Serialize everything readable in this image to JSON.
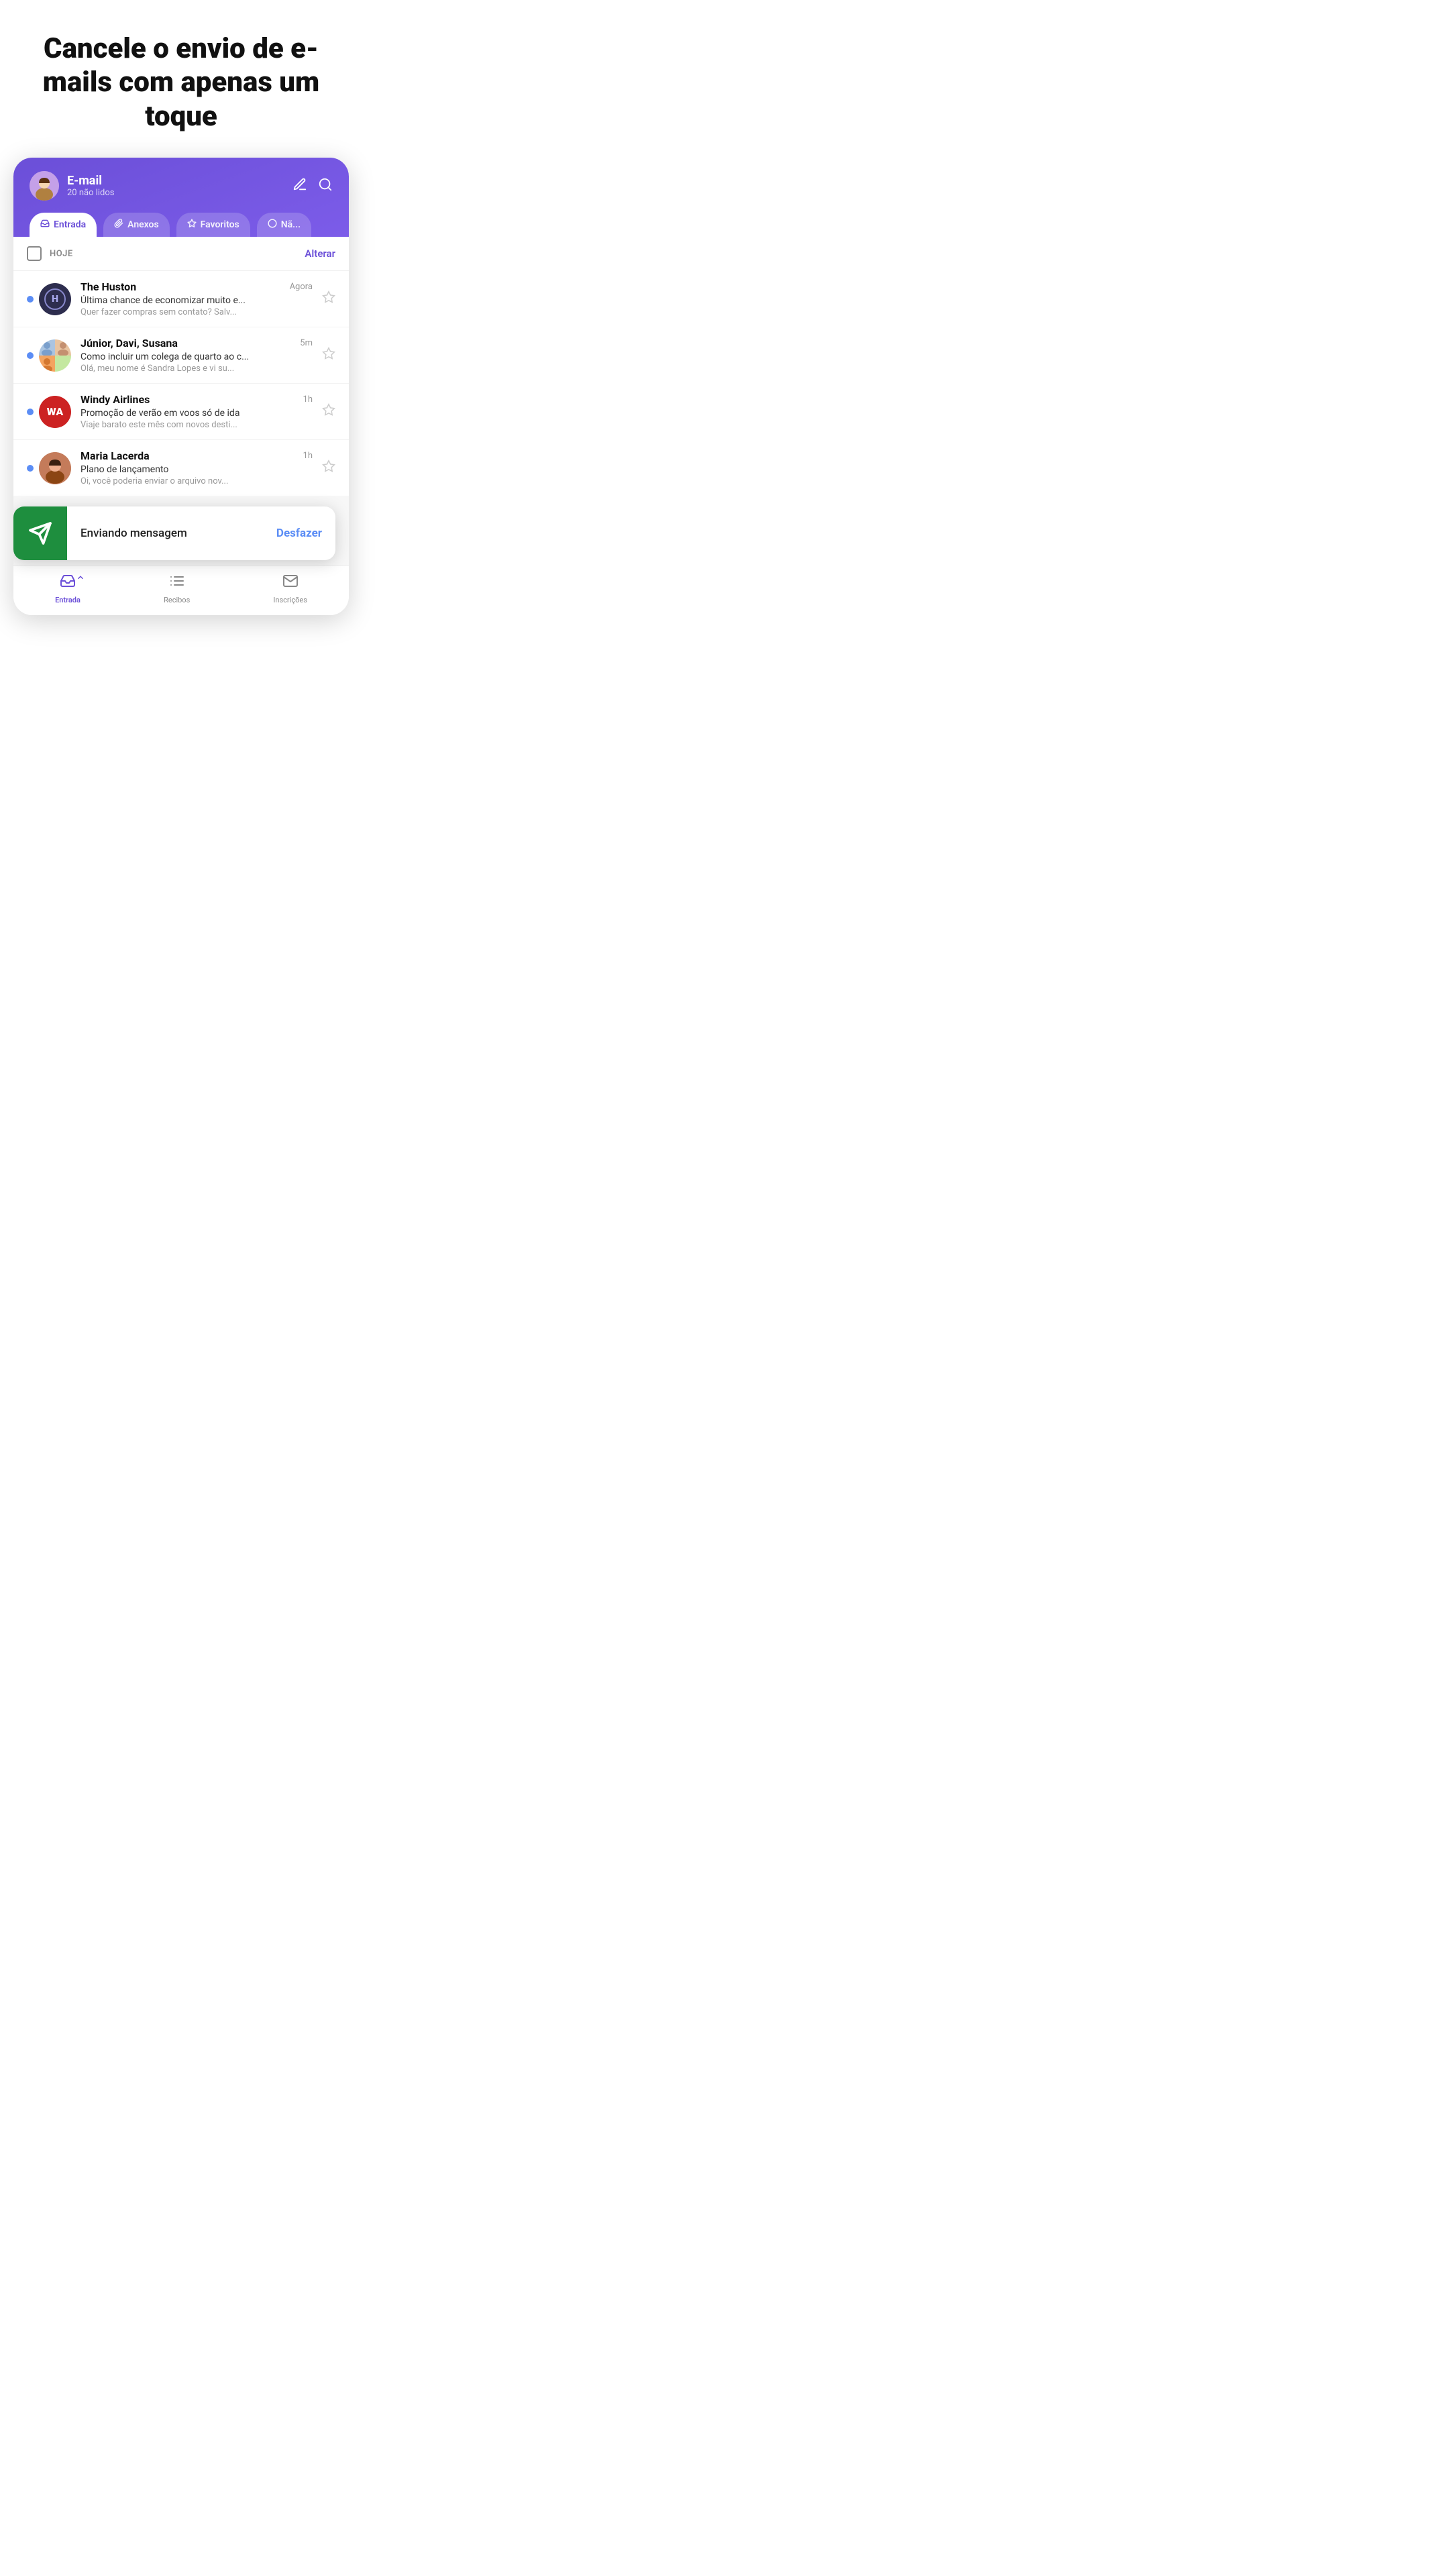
{
  "hero": {
    "title": "Cancele o envio de e-mails com apenas um toque"
  },
  "header": {
    "title": "E-mail",
    "subtitle": "20 não lidos",
    "edit_icon": "✏",
    "search_icon": "⌕"
  },
  "tabs": [
    {
      "id": "entrada",
      "label": "Entrada",
      "icon": "inbox",
      "active": true
    },
    {
      "id": "anexos",
      "label": "Anexos",
      "icon": "attachment",
      "active": false
    },
    {
      "id": "favoritos",
      "label": "Favoritos",
      "icon": "star",
      "active": false
    },
    {
      "id": "nao-lidos",
      "label": "Nã...",
      "icon": "circle",
      "active": false
    }
  ],
  "list_header": {
    "section_label": "HOJE",
    "action_label": "Alterar"
  },
  "emails": [
    {
      "id": 1,
      "sender": "The Huston",
      "subject": "Última chance de economizar muito e...",
      "preview": "Quer fazer compras sem contato? Salv...",
      "time": "Agora",
      "unread": true,
      "avatar_type": "huston"
    },
    {
      "id": 2,
      "sender": "Júnior, Davi, Susana",
      "subject": "Como incluir um colega de quarto ao c...",
      "preview": "Olá, meu nome é Sandra Lopes e vi su...",
      "time": "5m",
      "unread": true,
      "avatar_type": "group"
    },
    {
      "id": 3,
      "sender": "Windy Airlines",
      "subject": "Promoção de verão em voos só de ida",
      "preview": "Viaje barato este mês com novos desti...",
      "time": "1h",
      "unread": true,
      "avatar_type": "windy",
      "avatar_text": "WA"
    },
    {
      "id": 4,
      "sender": "Maria Lacerda",
      "subject": "Plano de lançamento",
      "preview": "Oi, você poderia enviar o arquivo nov...",
      "time": "1h",
      "unread": true,
      "avatar_type": "maria"
    }
  ],
  "toast": {
    "message": "Enviando mensagem",
    "undo_label": "Desfazer"
  },
  "bottom_nav": [
    {
      "id": "entrada",
      "label": "Entrada",
      "icon": "inbox",
      "active": true
    },
    {
      "id": "recibos",
      "label": "Recibos",
      "icon": "list",
      "active": false
    },
    {
      "id": "inscricoes",
      "label": "Inscrições",
      "icon": "mail",
      "active": false
    }
  ]
}
